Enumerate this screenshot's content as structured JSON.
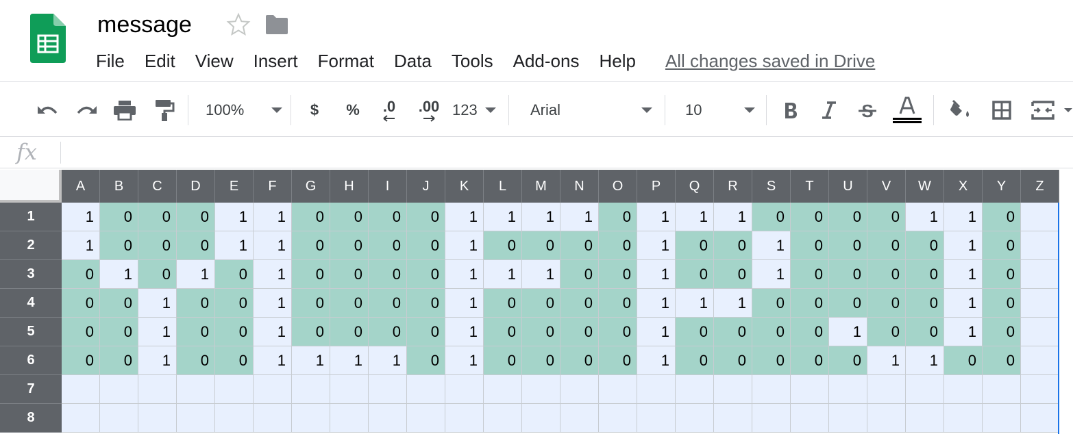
{
  "document": {
    "title": "message",
    "save_status": "All changes saved in Drive"
  },
  "menu": [
    "File",
    "Edit",
    "View",
    "Insert",
    "Format",
    "Data",
    "Tools",
    "Add-ons",
    "Help"
  ],
  "toolbar": {
    "zoom": "100%",
    "currency": "$",
    "percent": "%",
    "decrease_decimal": ".0",
    "increase_decimal": ".00",
    "more_formats": "123",
    "font": "Arial",
    "font_size": "10"
  },
  "formula_bar": {
    "icon": "fx",
    "value": ""
  },
  "colors": {
    "cell_one": "#e8f0fe",
    "cell_zero": "#a4d4c9",
    "header_bg": "#5f6368",
    "sheets_green": "#0f9d58"
  },
  "columns": [
    "A",
    "B",
    "C",
    "D",
    "E",
    "F",
    "G",
    "H",
    "I",
    "J",
    "K",
    "L",
    "M",
    "N",
    "O",
    "P",
    "Q",
    "R",
    "S",
    "T",
    "U",
    "V",
    "W",
    "X",
    "Y",
    "Z"
  ],
  "rows": [
    {
      "label": "1",
      "values": [
        "1",
        "0",
        "0",
        "0",
        "1",
        "1",
        "0",
        "0",
        "0",
        "0",
        "1",
        "1",
        "1",
        "1",
        "0",
        "1",
        "1",
        "1",
        "0",
        "0",
        "0",
        "0",
        "1",
        "1",
        "0",
        ""
      ]
    },
    {
      "label": "2",
      "values": [
        "1",
        "0",
        "0",
        "0",
        "1",
        "1",
        "0",
        "0",
        "0",
        "0",
        "1",
        "0",
        "0",
        "0",
        "0",
        "1",
        "0",
        "0",
        "1",
        "0",
        "0",
        "0",
        "0",
        "1",
        "0",
        ""
      ]
    },
    {
      "label": "3",
      "values": [
        "0",
        "1",
        "0",
        "1",
        "0",
        "1",
        "0",
        "0",
        "0",
        "0",
        "1",
        "1",
        "1",
        "0",
        "0",
        "1",
        "0",
        "0",
        "1",
        "0",
        "0",
        "0",
        "0",
        "1",
        "0",
        ""
      ]
    },
    {
      "label": "4",
      "values": [
        "0",
        "0",
        "1",
        "0",
        "0",
        "1",
        "0",
        "0",
        "0",
        "0",
        "1",
        "0",
        "0",
        "0",
        "0",
        "1",
        "1",
        "1",
        "0",
        "0",
        "0",
        "0",
        "0",
        "1",
        "0",
        ""
      ]
    },
    {
      "label": "5",
      "values": [
        "0",
        "0",
        "1",
        "0",
        "0",
        "1",
        "0",
        "0",
        "0",
        "0",
        "1",
        "0",
        "0",
        "0",
        "0",
        "1",
        "0",
        "0",
        "0",
        "0",
        "1",
        "0",
        "0",
        "1",
        "0",
        ""
      ]
    },
    {
      "label": "6",
      "values": [
        "0",
        "0",
        "1",
        "0",
        "0",
        "1",
        "1",
        "1",
        "1",
        "0",
        "1",
        "0",
        "0",
        "0",
        "0",
        "1",
        "0",
        "0",
        "0",
        "0",
        "0",
        "1",
        "1",
        "0",
        "0",
        ""
      ]
    },
    {
      "label": "7",
      "values": [
        "",
        "",
        "",
        "",
        "",
        "",
        "",
        "",
        "",
        "",
        "",
        "",
        "",
        "",
        "",
        "",
        "",
        "",
        "",
        "",
        "",
        "",
        "",
        "",
        "",
        ""
      ]
    },
    {
      "label": "8",
      "values": [
        "",
        "",
        "",
        "",
        "",
        "",
        "",
        "",
        "",
        "",
        "",
        "",
        "",
        "",
        "",
        "",
        "",
        "",
        "",
        "",
        "",
        "",
        "",
        "",
        "",
        ""
      ]
    }
  ]
}
